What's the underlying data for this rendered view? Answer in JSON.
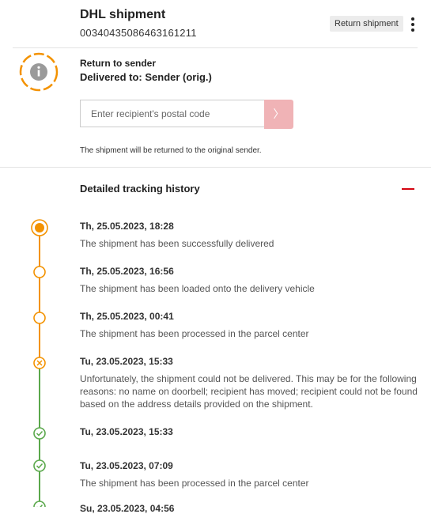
{
  "header": {
    "title": "DHL shipment",
    "tracking_number": "00340435086463161211",
    "return_button": "Return shipment",
    "menu_icon": "kebab-menu-icon"
  },
  "status": {
    "icon": "info-icon",
    "heading": "Return to sender",
    "delivered_to": "Delivered to:  Sender (orig.)"
  },
  "postal_form": {
    "placeholder": "Enter recipient's postal code",
    "submit_icon": "chevron-right-icon",
    "submit_glyph": "〉"
  },
  "note": "The shipment will be returned to the original sender.",
  "history": {
    "title": "Detailed tracking history",
    "collapse_icon": "minus-icon",
    "events": [
      {
        "date": "Th, 25.05.2023, 18:28",
        "text": "The shipment has been successfully delivered",
        "state": "current"
      },
      {
        "date": "Th, 25.05.2023, 16:56",
        "text": "The shipment has been loaded onto the delivery vehicle",
        "state": "done"
      },
      {
        "date": "Th, 25.05.2023, 00:41",
        "text": "The shipment has been processed in the parcel center",
        "state": "done"
      },
      {
        "date": "Tu, 23.05.2023, 15:33",
        "text": "Unfortunately, the shipment could not be delivered. This may be for the following reasons: no name on doorbell; recipient has moved; recipient could not be found based on the address details provided on the shipment.",
        "state": "failed"
      },
      {
        "date": "Tu, 23.05.2023, 15:33",
        "text": "",
        "state": "ok"
      },
      {
        "date": "Tu, 23.05.2023, 07:09",
        "text": "The shipment has been processed in the parcel center",
        "state": "ok"
      },
      {
        "date": "Su, 23.05.2023, 04:56",
        "text": "",
        "state": "ok"
      }
    ]
  },
  "colors": {
    "orange": "#f39200",
    "green": "#5aa84b",
    "dhl_red": "#d40511"
  }
}
